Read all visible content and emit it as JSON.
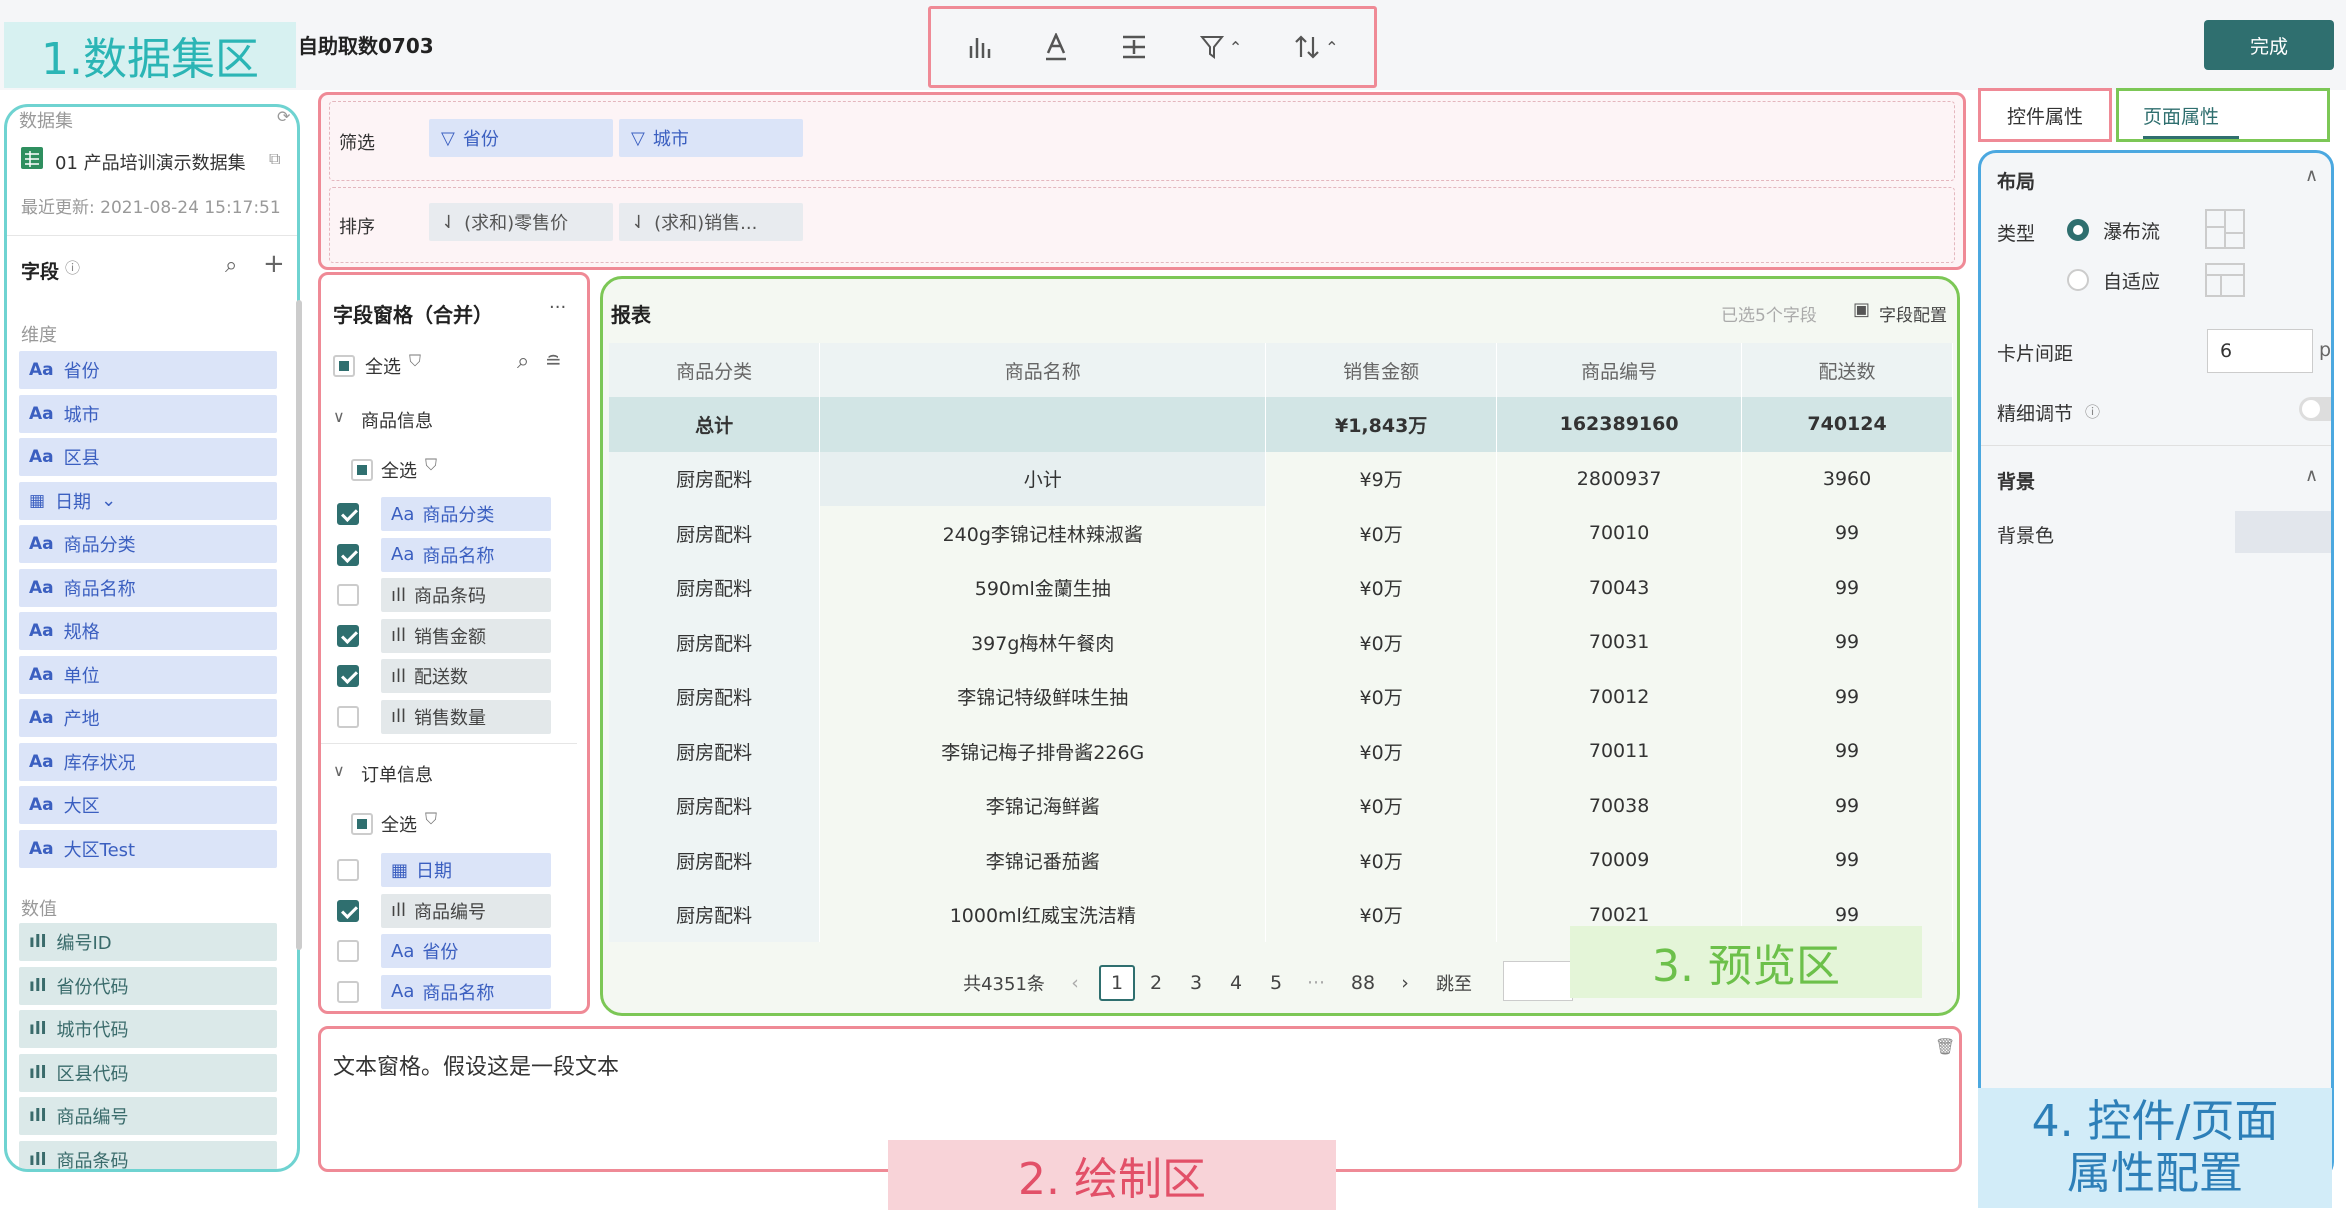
{
  "header": {
    "title": "自助取数0703",
    "done_label": "完成"
  },
  "annotations": {
    "dataset": "1.数据集区",
    "draw": "2. 绘制区",
    "preview": "3. 预览区",
    "props_line1": "4. 控件/页面",
    "props_line2": "属性配置"
  },
  "dataset_panel": {
    "section_label": "数据集",
    "dataset_name": "01 产品培训演示数据集",
    "last_update": "最近更新: 2021-08-24 15:17:51",
    "fields_label": "字段",
    "dimension_label": "维度",
    "measure_label": "数值",
    "dimensions": [
      "省份",
      "城市",
      "区县",
      "日期",
      "商品分类",
      "商品名称",
      "规格",
      "单位",
      "产地",
      "库存状况",
      "大区",
      "大区Test"
    ],
    "measures": [
      "编号ID",
      "省份代码",
      "城市代码",
      "区县代码",
      "商品编号",
      "商品条码"
    ]
  },
  "filter_area": {
    "filter_label": "筛选",
    "filters": [
      "省份",
      "城市"
    ],
    "sort_label": "排序",
    "sorts": [
      "(求和)零售价",
      "(求和)销售..."
    ]
  },
  "fields_panel": {
    "title": "字段窗格（合并）",
    "more": "···",
    "select_all": "全选",
    "group1": "商品信息",
    "group1_fields": [
      {
        "name": "商品分类",
        "type": "dim",
        "checked": true
      },
      {
        "name": "商品名称",
        "type": "dim",
        "checked": true
      },
      {
        "name": "商品条码",
        "type": "mea",
        "checked": false
      },
      {
        "name": "销售金额",
        "type": "mea",
        "checked": true
      },
      {
        "name": "配送数",
        "type": "mea",
        "checked": true
      },
      {
        "name": "销售数量",
        "type": "mea",
        "checked": false
      }
    ],
    "group2": "订单信息",
    "group2_fields": [
      {
        "name": "日期",
        "type": "dim",
        "checked": false
      },
      {
        "name": "商品编号",
        "type": "mea",
        "checked": true
      },
      {
        "name": "省份",
        "type": "dim",
        "checked": false
      },
      {
        "name": "商品名称",
        "type": "dim",
        "checked": false
      }
    ]
  },
  "preview": {
    "title": "报表",
    "selected_info": "已选5个字段",
    "config_label": "字段配置",
    "columns": [
      "商品分类",
      "商品名称",
      "销售金额",
      "商品编号",
      "配送数"
    ],
    "total_row": [
      "总计",
      "",
      "¥1,843万",
      "162389160",
      "740124"
    ],
    "rows": [
      [
        "厨房配料",
        "小计",
        "¥9万",
        "2800937",
        "3960"
      ],
      [
        "厨房配料",
        "240g李锦记桂林辣淑酱",
        "¥0万",
        "70010",
        "99"
      ],
      [
        "厨房配料",
        "590ml金蘭生抽",
        "¥0万",
        "70043",
        "99"
      ],
      [
        "厨房配料",
        "397g梅林午餐肉",
        "¥0万",
        "70031",
        "99"
      ],
      [
        "厨房配料",
        "李锦记特级鲜味生抽",
        "¥0万",
        "70012",
        "99"
      ],
      [
        "厨房配料",
        "李锦记梅子排骨酱226G",
        "¥0万",
        "70011",
        "99"
      ],
      [
        "厨房配料",
        "李锦记海鲜酱",
        "¥0万",
        "70038",
        "99"
      ],
      [
        "厨房配料",
        "李锦记番茄酱",
        "¥0万",
        "70009",
        "99"
      ],
      [
        "厨房配料",
        "1000ml红威宝洗洁精",
        "¥0万",
        "70021",
        "99"
      ]
    ],
    "pager": {
      "total": "共4351条",
      "pages": [
        "1",
        "2",
        "3",
        "4",
        "5",
        "···",
        "88"
      ],
      "jump": "跳至"
    }
  },
  "text_area": {
    "content": "文本窗格。假设这是一段文本"
  },
  "props": {
    "tab_control": "控件属性",
    "tab_page": "页面属性",
    "layout_title": "布局",
    "type_label": "类型",
    "type_opt1": "瀑布流",
    "type_opt2": "自适应",
    "gap_label": "卡片间距",
    "gap_value": "6",
    "gap_unit": "px",
    "fine_label": "精细调节",
    "bg_title": "背景",
    "bg_color_label": "背景色"
  }
}
